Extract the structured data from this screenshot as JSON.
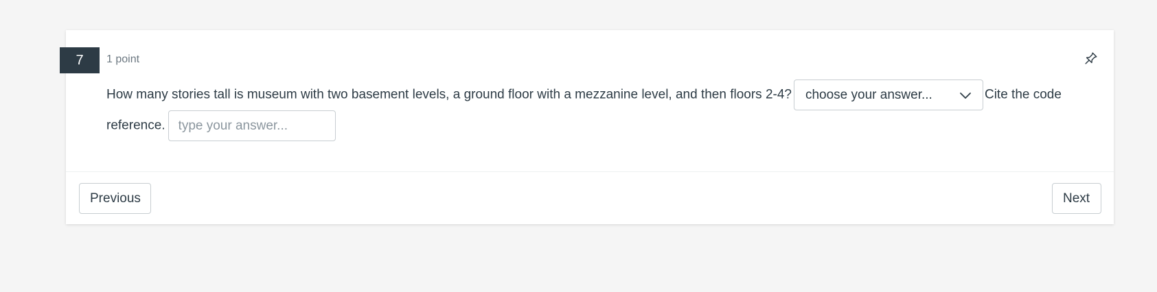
{
  "question": {
    "number": "7",
    "points": "1 point",
    "text_before": "How many stories tall is museum with two basement levels, a ground floor with a mezzanine level, and then floors 2-4?",
    "text_middle": "Cite the code reference.",
    "dropdown": {
      "selected": "choose your answer...",
      "icon": "chevron-down-icon"
    },
    "text_field": {
      "value": "",
      "placeholder": "type your answer..."
    },
    "pin_icon": "pin-icon"
  },
  "navigation": {
    "previous_label": "Previous",
    "next_label": "Next"
  },
  "colors": {
    "page_background": "#f5f5f5",
    "card_background": "#ffffff",
    "badge_background": "#2d3b45",
    "text": "#2d3b45",
    "muted_text": "#6b7780",
    "border": "#c7cdd1"
  }
}
